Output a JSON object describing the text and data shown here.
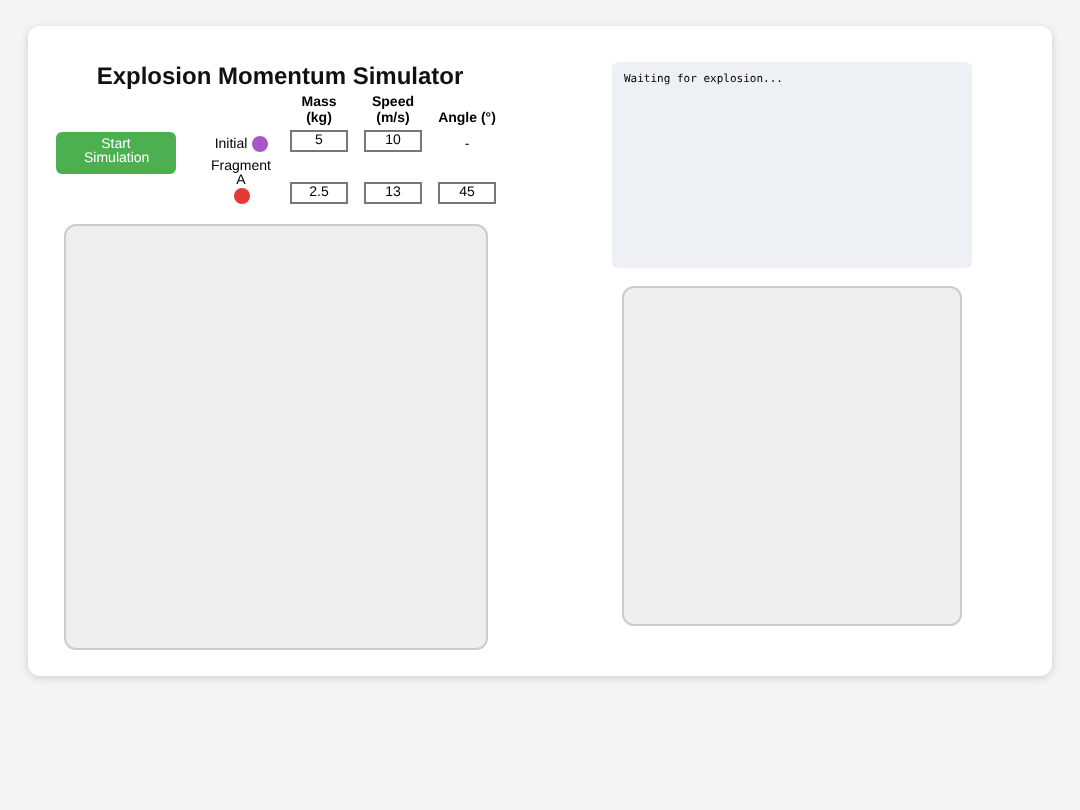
{
  "title": "Explosion Momentum Simulator",
  "start_button": "Start Simulation",
  "columns": [
    "Mass (kg)",
    "Speed (m/s)",
    "Angle (°)"
  ],
  "rows": [
    {
      "label": "Initial",
      "color": "#a855c7",
      "mass": "5",
      "speed": "10",
      "angle": "-",
      "kind": "text"
    },
    {
      "label": "Fragment A",
      "color": "#e53935",
      "mass": "2.5",
      "speed": "13",
      "angle": "45",
      "kind": "input"
    }
  ],
  "log": "Waiting for explosion..."
}
